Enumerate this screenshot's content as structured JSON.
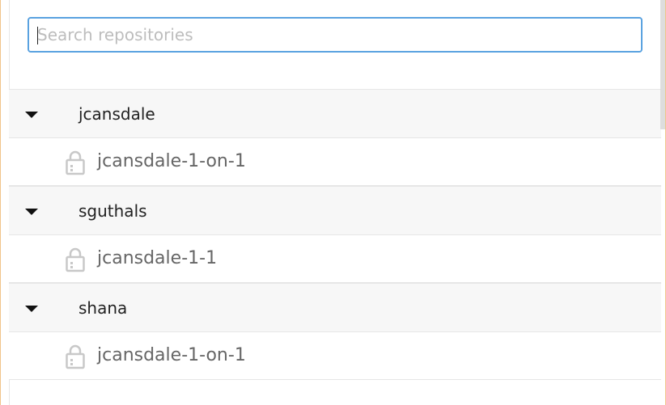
{
  "search": {
    "placeholder": "Search repositories",
    "value": ""
  },
  "groups": [
    {
      "owner": "jcansdale",
      "repos": [
        {
          "name": "jcansdale-1-on-1",
          "icon": "lock-icon"
        }
      ]
    },
    {
      "owner": "sguthals",
      "repos": [
        {
          "name": "jcansdale-1-1",
          "icon": "lock-icon"
        }
      ]
    },
    {
      "owner": "shana",
      "repos": [
        {
          "name": "jcansdale-1-on-1",
          "icon": "lock-icon"
        }
      ]
    }
  ],
  "colors": {
    "accent": "#5aa2e0",
    "frame_border": "#f0c48a",
    "header_bg": "#f7f7f7",
    "text_muted": "#666666"
  }
}
